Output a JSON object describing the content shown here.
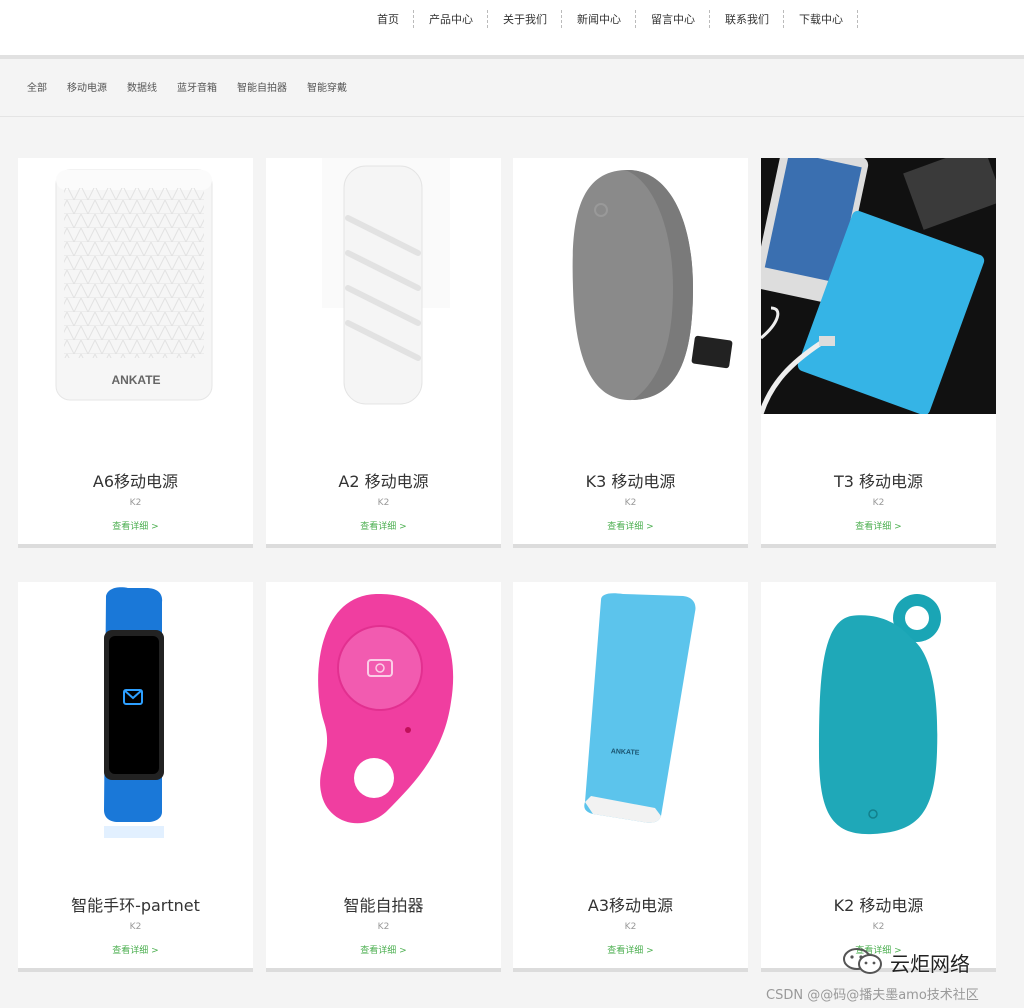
{
  "nav": {
    "items": [
      {
        "label": "首页"
      },
      {
        "label": "产品中心"
      },
      {
        "label": "关于我们"
      },
      {
        "label": "新闻中心"
      },
      {
        "label": "留言中心"
      },
      {
        "label": "联系我们"
      },
      {
        "label": "下载中心"
      }
    ]
  },
  "filters": {
    "items": [
      {
        "label": "全部"
      },
      {
        "label": "移动电源"
      },
      {
        "label": "数据线"
      },
      {
        "label": "蓝牙音箱"
      },
      {
        "label": "智能自拍器"
      },
      {
        "label": "智能穿戴"
      }
    ]
  },
  "products": [
    {
      "title": "A6移动电源",
      "sub": "K2",
      "link": "查看详细 >",
      "image": "white-textured-power-bank",
      "brand": "ANKATE"
    },
    {
      "title": "A2 移动电源",
      "sub": "K2",
      "link": "查看详细 >",
      "image": "white-twisted-power-bank"
    },
    {
      "title": "K3 移动电源",
      "sub": "K2",
      "link": "查看详细 >",
      "image": "gray-pebble-power-bank"
    },
    {
      "title": "T3 移动电源",
      "sub": "K2",
      "link": "查看详细 >",
      "image": "blue-slim-power-bank-with-phone"
    },
    {
      "title": "智能手环-partnet",
      "sub": "K2",
      "link": "查看详细 >",
      "image": "blue-smart-band"
    },
    {
      "title": "智能自拍器",
      "sub": "K2",
      "link": "查看详细 >",
      "image": "pink-selfie-remote"
    },
    {
      "title": "A3移动电源",
      "sub": "K2",
      "link": "查看详细 >",
      "image": "blue-cylinder-power-bank",
      "brand": "ANKATE"
    },
    {
      "title": "K2 移动电源",
      "sub": "K2",
      "link": "查看详细 >",
      "image": "teal-ring-power-bank"
    }
  ],
  "watermark": {
    "brand": "云炬网络",
    "csdn": "CSDN @@码@播夫墨amo技术社区"
  },
  "colors": {
    "link": "#4caf50",
    "page_bg": "#f4f4f4",
    "card_bg": "#ffffff"
  }
}
